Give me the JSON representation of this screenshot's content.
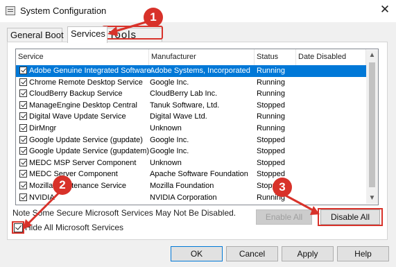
{
  "window": {
    "title": "System Configuration",
    "close_glyph": "✕"
  },
  "tabs": [
    {
      "label": "General Boot",
      "active": false
    },
    {
      "label": "Services",
      "active": true
    },
    {
      "label": "Tools",
      "active": false
    }
  ],
  "list": {
    "headers": [
      "Service",
      "Manufacturer",
      "Status",
      "Date Disabled"
    ],
    "rows": [
      {
        "checked": true,
        "selected": true,
        "service": "Adobe Genuine Integrated Software...",
        "manufacturer": "Adobe Systems, Incorporated",
        "status": "Running",
        "date": ""
      },
      {
        "checked": true,
        "selected": false,
        "service": "Chrome Remote Desktop Service",
        "manufacturer": "Google Inc.",
        "status": "Running",
        "date": ""
      },
      {
        "checked": true,
        "selected": false,
        "service": "CloudBerry Backup Service",
        "manufacturer": "CloudBerry Lab Inc.",
        "status": "Running",
        "date": ""
      },
      {
        "checked": true,
        "selected": false,
        "service": "ManageEngine Desktop Central",
        "manufacturer": "Tanuk Software, Ltd.",
        "status": "Stopped",
        "date": ""
      },
      {
        "checked": true,
        "selected": false,
        "service": "Digital Wave Update Service",
        "manufacturer": "Digital Wave Ltd.",
        "status": "Running",
        "date": ""
      },
      {
        "checked": true,
        "selected": false,
        "service": "DirMngr",
        "manufacturer": "Unknown",
        "status": "Running",
        "date": ""
      },
      {
        "checked": true,
        "selected": false,
        "service": "Google Update Service (gupdate)",
        "manufacturer": "Google Inc.",
        "status": "Stopped",
        "date": ""
      },
      {
        "checked": true,
        "selected": false,
        "service": "Google Update Service (gupdatem)",
        "manufacturer": "Google Inc.",
        "status": "Stopped",
        "date": ""
      },
      {
        "checked": true,
        "selected": false,
        "service": "MEDC MSP Server Component",
        "manufacturer": "Unknown",
        "status": "Stopped",
        "date": ""
      },
      {
        "checked": true,
        "selected": false,
        "service": "MEDC Server Component",
        "manufacturer": "Apache Software Foundation",
        "status": "Stopped",
        "date": ""
      },
      {
        "checked": true,
        "selected": false,
        "service": "Mozilla Maintenance Service",
        "manufacturer": "Mozilla Foundation",
        "status": "Stopped",
        "date": ""
      },
      {
        "checked": true,
        "selected": false,
        "service": "NVIDIA",
        "manufacturer": "NVIDIA Corporation",
        "status": "Running",
        "date": ""
      }
    ],
    "scroll_up_glyph": "▲",
    "scroll_down_glyph": "▼"
  },
  "note": "Note Some Secure Microsoft Services May Not Be Disabled.",
  "buttons": {
    "enable_all": "Enable All",
    "disable_all": "Disable All"
  },
  "hide_ms": {
    "label": "Hide All Microsoft Services",
    "checked": true
  },
  "footer": {
    "ok": "OK",
    "cancel": "Cancel",
    "apply": "Apply",
    "help": "Help"
  },
  "annotations": {
    "badge1": "1",
    "badge2": "2",
    "badge3": "3",
    "color": "#d8322a"
  }
}
